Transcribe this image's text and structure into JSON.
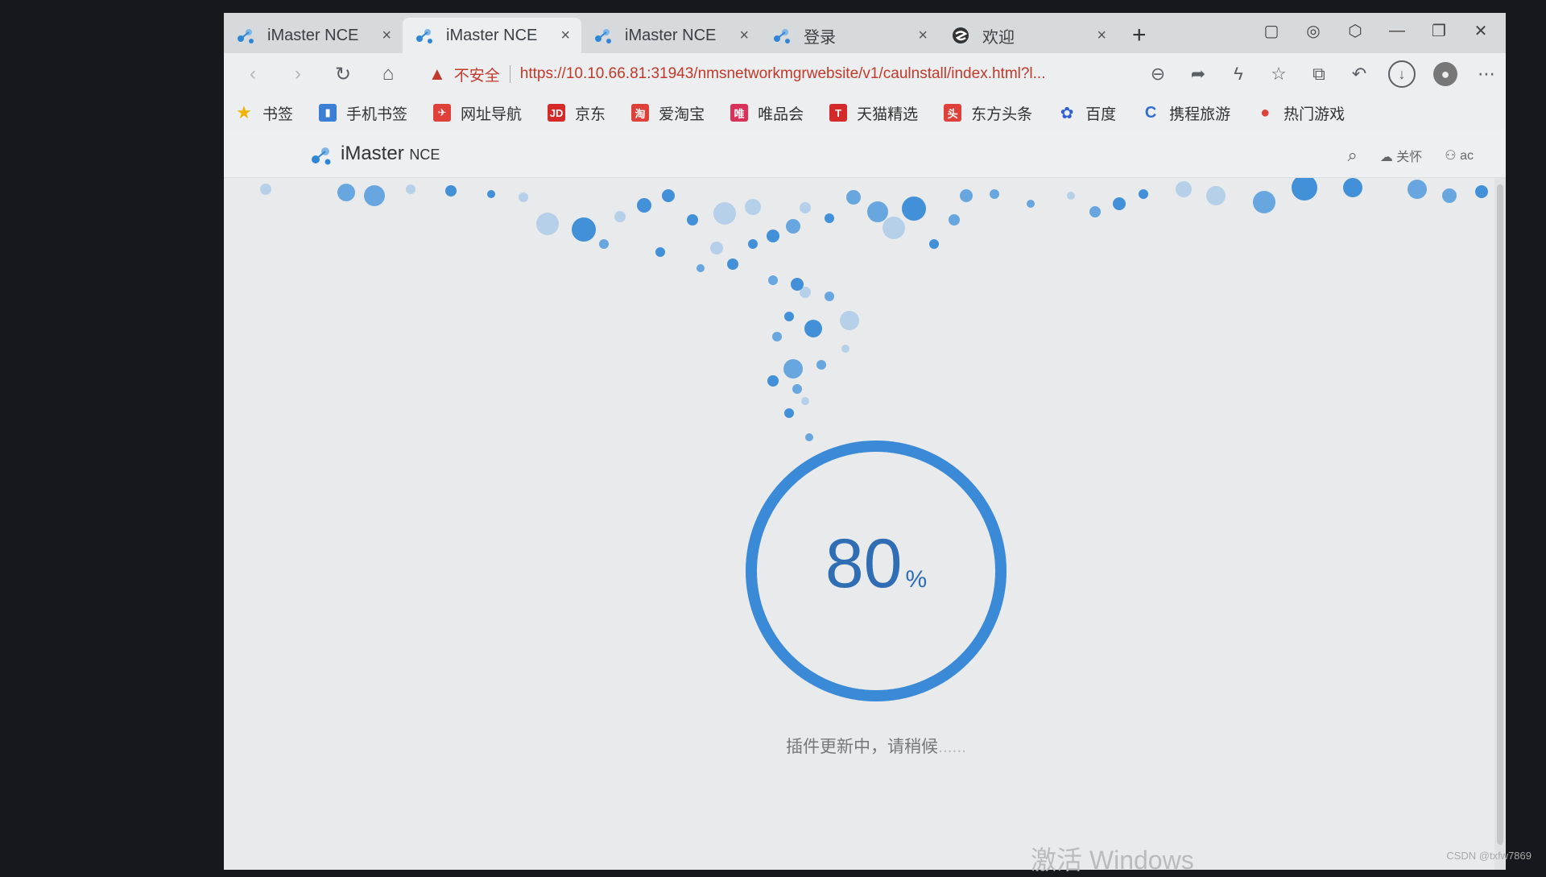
{
  "tabs": [
    {
      "title": "iMaster NCE",
      "icon": "nce-logo-icon",
      "close": "×",
      "active": false
    },
    {
      "title": "iMaster NCE",
      "icon": "nce-logo-icon",
      "close": "×",
      "active": true
    },
    {
      "title": "iMaster NCE",
      "icon": "nce-logo-icon",
      "close": "×",
      "active": false
    },
    {
      "title": "登录",
      "icon": "nce-logo-icon",
      "close": "×",
      "active": false
    },
    {
      "title": "欢迎",
      "icon": "browser-logo-icon",
      "close": "×",
      "active": false
    }
  ],
  "new_tab": "+",
  "address": {
    "security_label": "不安全",
    "url": "https://10.10.66.81:31943/nmsnetworkmgrwebsite/v1/caulnstall/index.html?l..."
  },
  "bookmarks": [
    {
      "label": "书签",
      "icon": "star-icon",
      "color": "#f0b400"
    },
    {
      "label": "手机书签",
      "icon": "phone-bookmark-icon",
      "color": "#3a7fd5"
    },
    {
      "label": "网址导航",
      "icon": "nav-icon",
      "color": "#e0403a"
    },
    {
      "label": "京东",
      "icon": "jd-icon",
      "color": "#d42a2a",
      "glyph": "JD"
    },
    {
      "label": "爱淘宝",
      "icon": "taobao-icon",
      "color": "#e0403a",
      "glyph": "淘"
    },
    {
      "label": "唯品会",
      "icon": "vip-icon",
      "color": "#d9315a",
      "glyph": "唯"
    },
    {
      "label": "天猫精选",
      "icon": "tmall-icon",
      "color": "#d42a2a",
      "glyph": "T"
    },
    {
      "label": "东方头条",
      "icon": "toutiao-icon",
      "color": "#e0403a",
      "glyph": "头"
    },
    {
      "label": "百度",
      "icon": "baidu-icon",
      "color": "#2f5fd0",
      "glyph": "✿"
    },
    {
      "label": "携程旅游",
      "icon": "ctrip-icon",
      "color": "#2f6fd0",
      "glyph": "C"
    },
    {
      "label": "热门游戏",
      "icon": "games-icon",
      "color": "#e0403a",
      "glyph": "●"
    }
  ],
  "app": {
    "title": "iMaster",
    "title_suffix": "NCE",
    "close_label": "关怀",
    "user_label": "ac"
  },
  "progress": {
    "value": "80",
    "unit": "%",
    "fraction": 0.8,
    "status": "插件更新中，请稍候",
    "status_dots": "......"
  },
  "watermark": "激活 Windows",
  "credit": "CSDN @txfw7869",
  "colors": {
    "accent": "#2f86d6",
    "accent_light": "#7fb6e6",
    "warning": "#c0392b"
  }
}
